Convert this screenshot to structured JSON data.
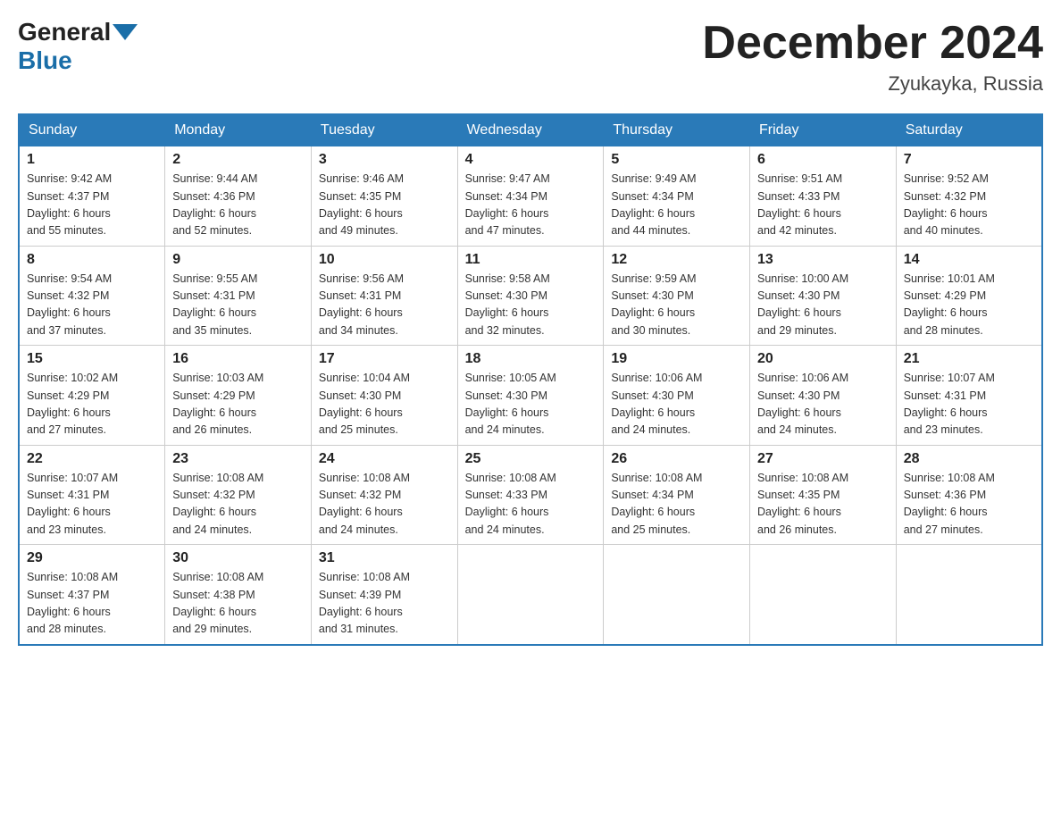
{
  "header": {
    "logo_general": "General",
    "logo_blue": "Blue",
    "month_title": "December 2024",
    "location": "Zyukayka, Russia"
  },
  "days_of_week": [
    "Sunday",
    "Monday",
    "Tuesday",
    "Wednesday",
    "Thursday",
    "Friday",
    "Saturday"
  ],
  "weeks": [
    [
      {
        "day": "1",
        "sunrise": "9:42 AM",
        "sunset": "4:37 PM",
        "daylight": "6 hours and 55 minutes."
      },
      {
        "day": "2",
        "sunrise": "9:44 AM",
        "sunset": "4:36 PM",
        "daylight": "6 hours and 52 minutes."
      },
      {
        "day": "3",
        "sunrise": "9:46 AM",
        "sunset": "4:35 PM",
        "daylight": "6 hours and 49 minutes."
      },
      {
        "day": "4",
        "sunrise": "9:47 AM",
        "sunset": "4:34 PM",
        "daylight": "6 hours and 47 minutes."
      },
      {
        "day": "5",
        "sunrise": "9:49 AM",
        "sunset": "4:34 PM",
        "daylight": "6 hours and 44 minutes."
      },
      {
        "day": "6",
        "sunrise": "9:51 AM",
        "sunset": "4:33 PM",
        "daylight": "6 hours and 42 minutes."
      },
      {
        "day": "7",
        "sunrise": "9:52 AM",
        "sunset": "4:32 PM",
        "daylight": "6 hours and 40 minutes."
      }
    ],
    [
      {
        "day": "8",
        "sunrise": "9:54 AM",
        "sunset": "4:32 PM",
        "daylight": "6 hours and 37 minutes."
      },
      {
        "day": "9",
        "sunrise": "9:55 AM",
        "sunset": "4:31 PM",
        "daylight": "6 hours and 35 minutes."
      },
      {
        "day": "10",
        "sunrise": "9:56 AM",
        "sunset": "4:31 PM",
        "daylight": "6 hours and 34 minutes."
      },
      {
        "day": "11",
        "sunrise": "9:58 AM",
        "sunset": "4:30 PM",
        "daylight": "6 hours and 32 minutes."
      },
      {
        "day": "12",
        "sunrise": "9:59 AM",
        "sunset": "4:30 PM",
        "daylight": "6 hours and 30 minutes."
      },
      {
        "day": "13",
        "sunrise": "10:00 AM",
        "sunset": "4:30 PM",
        "daylight": "6 hours and 29 minutes."
      },
      {
        "day": "14",
        "sunrise": "10:01 AM",
        "sunset": "4:29 PM",
        "daylight": "6 hours and 28 minutes."
      }
    ],
    [
      {
        "day": "15",
        "sunrise": "10:02 AM",
        "sunset": "4:29 PM",
        "daylight": "6 hours and 27 minutes."
      },
      {
        "day": "16",
        "sunrise": "10:03 AM",
        "sunset": "4:29 PM",
        "daylight": "6 hours and 26 minutes."
      },
      {
        "day": "17",
        "sunrise": "10:04 AM",
        "sunset": "4:30 PM",
        "daylight": "6 hours and 25 minutes."
      },
      {
        "day": "18",
        "sunrise": "10:05 AM",
        "sunset": "4:30 PM",
        "daylight": "6 hours and 24 minutes."
      },
      {
        "day": "19",
        "sunrise": "10:06 AM",
        "sunset": "4:30 PM",
        "daylight": "6 hours and 24 minutes."
      },
      {
        "day": "20",
        "sunrise": "10:06 AM",
        "sunset": "4:30 PM",
        "daylight": "6 hours and 24 minutes."
      },
      {
        "day": "21",
        "sunrise": "10:07 AM",
        "sunset": "4:31 PM",
        "daylight": "6 hours and 23 minutes."
      }
    ],
    [
      {
        "day": "22",
        "sunrise": "10:07 AM",
        "sunset": "4:31 PM",
        "daylight": "6 hours and 23 minutes."
      },
      {
        "day": "23",
        "sunrise": "10:08 AM",
        "sunset": "4:32 PM",
        "daylight": "6 hours and 24 minutes."
      },
      {
        "day": "24",
        "sunrise": "10:08 AM",
        "sunset": "4:32 PM",
        "daylight": "6 hours and 24 minutes."
      },
      {
        "day": "25",
        "sunrise": "10:08 AM",
        "sunset": "4:33 PM",
        "daylight": "6 hours and 24 minutes."
      },
      {
        "day": "26",
        "sunrise": "10:08 AM",
        "sunset": "4:34 PM",
        "daylight": "6 hours and 25 minutes."
      },
      {
        "day": "27",
        "sunrise": "10:08 AM",
        "sunset": "4:35 PM",
        "daylight": "6 hours and 26 minutes."
      },
      {
        "day": "28",
        "sunrise": "10:08 AM",
        "sunset": "4:36 PM",
        "daylight": "6 hours and 27 minutes."
      }
    ],
    [
      {
        "day": "29",
        "sunrise": "10:08 AM",
        "sunset": "4:37 PM",
        "daylight": "6 hours and 28 minutes."
      },
      {
        "day": "30",
        "sunrise": "10:08 AM",
        "sunset": "4:38 PM",
        "daylight": "6 hours and 29 minutes."
      },
      {
        "day": "31",
        "sunrise": "10:08 AM",
        "sunset": "4:39 PM",
        "daylight": "6 hours and 31 minutes."
      },
      null,
      null,
      null,
      null
    ]
  ]
}
